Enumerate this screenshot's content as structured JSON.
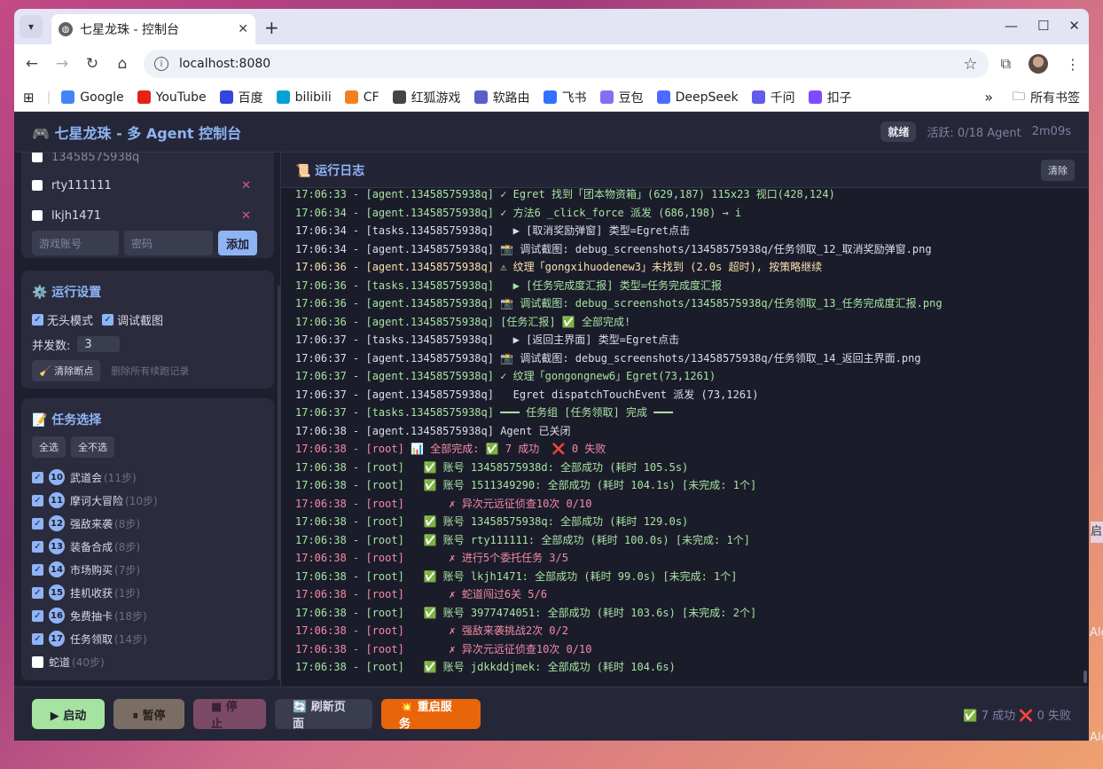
{
  "browser": {
    "tab_title": "七星龙珠 - 控制台",
    "url": "localhost:8080",
    "bookmarks": [
      {
        "label": "Google",
        "color": "#4285f4"
      },
      {
        "label": "YouTube",
        "color": "#e62117"
      },
      {
        "label": "百度",
        "color": "#3245df"
      },
      {
        "label": "bilibili",
        "color": "#00a1d6"
      },
      {
        "label": "CF",
        "color": "#f38020"
      },
      {
        "label": "红狐游戏",
        "color": "#444444"
      },
      {
        "label": "软路由",
        "color": "#5b5fc7"
      },
      {
        "label": "飞书",
        "color": "#3370ff"
      },
      {
        "label": "豆包",
        "color": "#8a6cf0"
      },
      {
        "label": "DeepSeek",
        "color": "#4d6bfe"
      },
      {
        "label": "千问",
        "color": "#615ced"
      },
      {
        "label": "扣子",
        "color": "#7b4dff"
      }
    ],
    "all_bookmarks": "所有书签"
  },
  "header": {
    "title": "🎮 七星龙珠 - 多 Agent 控制台",
    "status": "就绪",
    "active": "活跃: 0/18 Agent",
    "uptime": "2m09s"
  },
  "accounts": {
    "partial": "13458575938q",
    "items": [
      "rty111111",
      "lkjh1471"
    ],
    "account_placeholder": "游戏账号",
    "password_placeholder": "密码",
    "add_label": "添加"
  },
  "settings": {
    "title": "⚙️ 运行设置",
    "headless": "无头模式",
    "debug_shot": "调试截图",
    "concurrency_label": "并发数:",
    "concurrency": "3",
    "clear_btn": "🧹 清除断点",
    "clear_hint": "删除所有续跑记录"
  },
  "tasks": {
    "title": "📝 任务选择",
    "select_all": "全选",
    "select_none": "全不选",
    "items": [
      {
        "n": "10",
        "name": "武道会",
        "steps": "(11步)",
        "checked": true
      },
      {
        "n": "11",
        "name": "摩诃大冒险",
        "steps": "(10步)",
        "checked": true
      },
      {
        "n": "12",
        "name": "强敌来袭",
        "steps": "(8步)",
        "checked": true
      },
      {
        "n": "13",
        "name": "装备合成",
        "steps": "(8步)",
        "checked": true
      },
      {
        "n": "14",
        "name": "市场购买",
        "steps": "(7步)",
        "checked": true
      },
      {
        "n": "15",
        "name": "挂机收获",
        "steps": "(1步)",
        "checked": true
      },
      {
        "n": "16",
        "name": "免费抽卡",
        "steps": "(18步)",
        "checked": true
      },
      {
        "n": "17",
        "name": "任务领取",
        "steps": "(14步)",
        "checked": true
      },
      {
        "n": "",
        "name": "蛇道",
        "steps": "(40步)",
        "checked": false
      }
    ]
  },
  "log": {
    "title": "📜 运行日志",
    "clear": "清除",
    "lines": [
      {
        "t": "17:06:33 - [agent.13458575938q] ✓ Egret 找到「团本物资箱」(629,187) 115x23 视口(428,124)",
        "c": "ok"
      },
      {
        "t": "17:06:34 - [agent.13458575938q] ✓ 方法6 _click_force 派发 (686,198) → i",
        "c": "ok"
      },
      {
        "t": "17:06:34 - [tasks.13458575938q]   ▶ [取消奖励弹窗] 类型=Egret点击",
        "c": ""
      },
      {
        "t": "17:06:34 - [agent.13458575938q] 📸 调试截图: debug_screenshots/13458575938q/任务领取_12_取消奖励弹窗.png",
        "c": ""
      },
      {
        "t": "17:06:36 - [agent.13458575938q] ⚠ 纹理「gongxihuodenew3」未找到 (2.0s 超时), 按策略继续",
        "c": "warn"
      },
      {
        "t": "17:06:36 - [tasks.13458575938q]   ▶ [任务完成度汇报] 类型=任务完成度汇报",
        "c": "ok"
      },
      {
        "t": "17:06:36 - [agent.13458575938q] 📸 调试截图: debug_screenshots/13458575938q/任务领取_13_任务完成度汇报.png",
        "c": "ok"
      },
      {
        "t": "17:06:36 - [agent.13458575938q] [任务汇报] ✅ 全部完成!",
        "c": "ok"
      },
      {
        "t": "17:06:37 - [tasks.13458575938q]   ▶ [返回主界面] 类型=Egret点击",
        "c": ""
      },
      {
        "t": "17:06:37 - [agent.13458575938q] 📸 调试截图: debug_screenshots/13458575938q/任务领取_14_返回主界面.png",
        "c": ""
      },
      {
        "t": "17:06:37 - [agent.13458575938q] ✓ 纹理「gongongnew6」Egret(73,1261)",
        "c": "ok"
      },
      {
        "t": "17:06:37 - [agent.13458575938q]   Egret dispatchTouchEvent 派发 (73,1261)",
        "c": ""
      },
      {
        "t": "17:06:37 - [tasks.13458575938q] ━━━ 任务组 [任务领取] 完成 ━━━",
        "c": "ok"
      },
      {
        "t": "17:06:38 - [agent.13458575938q] Agent 已关闭",
        "c": ""
      },
      {
        "t": "17:06:38 - [root] 📊 全部完成: ✅ 7 成功  ❌ 0 失败",
        "c": "err"
      },
      {
        "t": "17:06:38 - [root]   ✅ 账号 13458575938d: 全部成功 (耗时 105.5s)",
        "c": "ok"
      },
      {
        "t": "17:06:38 - [root]   ✅ 账号 1511349290: 全部成功 (耗时 104.1s) [未完成: 1个]",
        "c": "ok"
      },
      {
        "t": "17:06:38 - [root]       ✗ 异次元远征侦查10次 0/10",
        "c": "err"
      },
      {
        "t": "17:06:38 - [root]   ✅ 账号 13458575938q: 全部成功 (耗时 129.0s)",
        "c": "ok"
      },
      {
        "t": "17:06:38 - [root]   ✅ 账号 rty111111: 全部成功 (耗时 100.0s) [未完成: 1个]",
        "c": "ok"
      },
      {
        "t": "17:06:38 - [root]       ✗ 进行5个委托任务 3/5",
        "c": "err"
      },
      {
        "t": "17:06:38 - [root]   ✅ 账号 lkjh1471: 全部成功 (耗时 99.0s) [未完成: 1个]",
        "c": "ok"
      },
      {
        "t": "17:06:38 - [root]       ✗ 蛇道闯过6关 5/6",
        "c": "err"
      },
      {
        "t": "17:06:38 - [root]   ✅ 账号 3977474051: 全部成功 (耗时 103.6s) [未完成: 2个]",
        "c": "ok"
      },
      {
        "t": "17:06:38 - [root]       ✗ 强敌来袭挑战2次 0/2",
        "c": "err"
      },
      {
        "t": "17:06:38 - [root]       ✗ 异次元远征侦查10次 0/10",
        "c": "err"
      },
      {
        "t": "17:06:38 - [root]   ✅ 账号 jdkkddjmek: 全部成功 (耗时 104.6s)",
        "c": "ok"
      }
    ]
  },
  "footer": {
    "start": "▶ 启动",
    "pause": "⏸ 暂停",
    "stop": "■ 停止",
    "refresh": "🔄 刷新页面",
    "restart": "💥 重启服务",
    "stats": "✅ 7 成功 ❌ 0 失败"
  },
  "desktop": {
    "right_edge_1": "启",
    "right_edge_2": "Alg",
    "right_edge_3": "Alg"
  }
}
